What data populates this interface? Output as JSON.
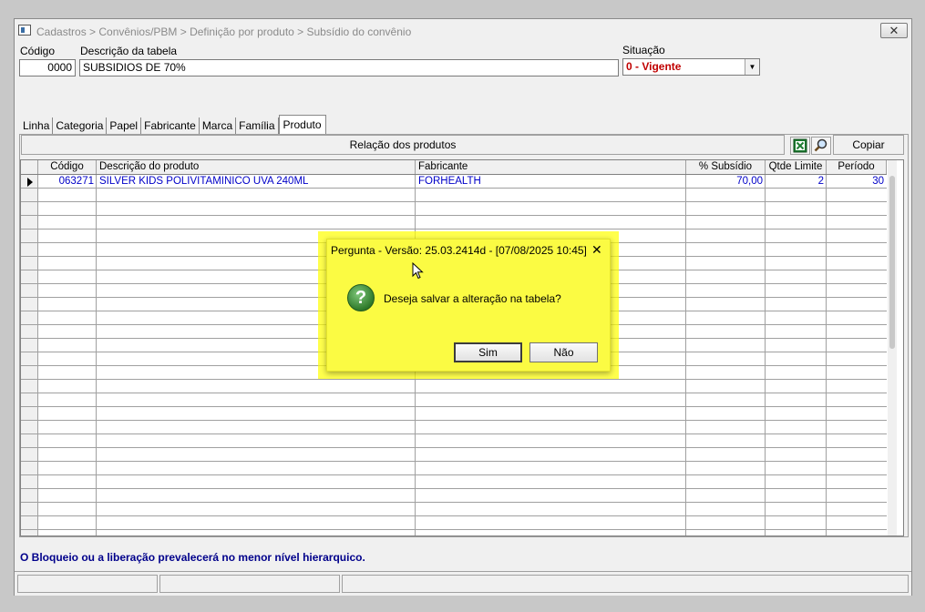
{
  "window": {
    "title": "Cadastros > Convênios/PBM > Definição por produto > Subsídio do convênio",
    "close_glyph": "✕"
  },
  "form": {
    "codigo_label": "Código",
    "codigo_value": "0000",
    "descricao_label": "Descrição da tabela",
    "descricao_value": "SUBSIDIOS DE 70%",
    "situacao_label": "Situação",
    "situacao_value": "0 - Vigente"
  },
  "tabs": [
    {
      "label": "Linha"
    },
    {
      "label": "Categoria"
    },
    {
      "label": "Papel"
    },
    {
      "label": "Fabricante"
    },
    {
      "label": "Marca"
    },
    {
      "label": "Família"
    },
    {
      "label": "Produto",
      "active": true
    }
  ],
  "toolbar": {
    "header_label": "Relação dos produtos",
    "excel_icon": "excel-icon",
    "search_icon": "magnifier-icon",
    "copy_label": "Copiar"
  },
  "grid": {
    "columns": [
      "Código",
      "Descrição do produto",
      "Fabricante",
      "% Subsídio",
      "Qtde Limite",
      "Período"
    ],
    "rows": [
      {
        "codigo": "063271",
        "descricao": "SILVER KIDS POLIVITAMINICO UVA 240ML",
        "fabricante": "FORHEALTH",
        "subsidio": "70,00",
        "qtde": "2",
        "periodo": "30"
      }
    ]
  },
  "footer_message": "O Bloqueio ou a liberação prevalecerá no menor nível hierarquico.",
  "dialog": {
    "title": "Pergunta - Versão: 25.03.2414d - [07/08/2025 10:45]",
    "close_glyph": "✕",
    "icon": "question-icon",
    "message": "Deseja salvar a alteração na tabela?",
    "yes_label": "Sim",
    "no_label": "Não"
  },
  "colors": {
    "highlight": "#ffff00",
    "grid_text": "#0000c8",
    "situacao_text": "#c00000",
    "footer_text": "#00008b"
  }
}
